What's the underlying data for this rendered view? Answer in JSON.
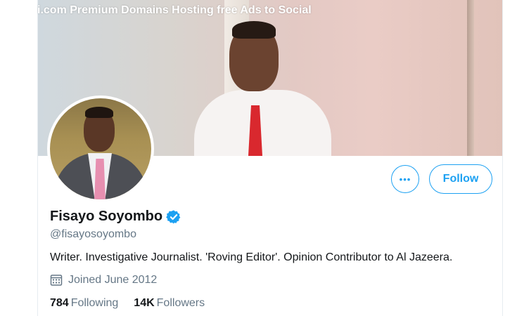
{
  "watermark": "i.com Premium Domains Hosting free Ads to Social",
  "profile": {
    "name": "Fisayo Soyombo",
    "handle": "@fisayosoyombo",
    "bio": "Writer. Investigative Journalist. 'Roving Editor'. Opinion Contributor to Al Jazeera.",
    "joined": "Joined June 2012",
    "following_count": "784",
    "following_label": "Following",
    "followers_count": "14K",
    "followers_label": "Followers",
    "verified": true
  },
  "actions": {
    "more_label": "•••",
    "follow_label": "Follow"
  },
  "icons": {
    "more": "more-options-icon",
    "verified": "verified-badge-icon",
    "calendar": "calendar-icon"
  },
  "colors": {
    "accent": "#1da1f2",
    "text_primary": "#14171a",
    "text_secondary": "#657786"
  }
}
